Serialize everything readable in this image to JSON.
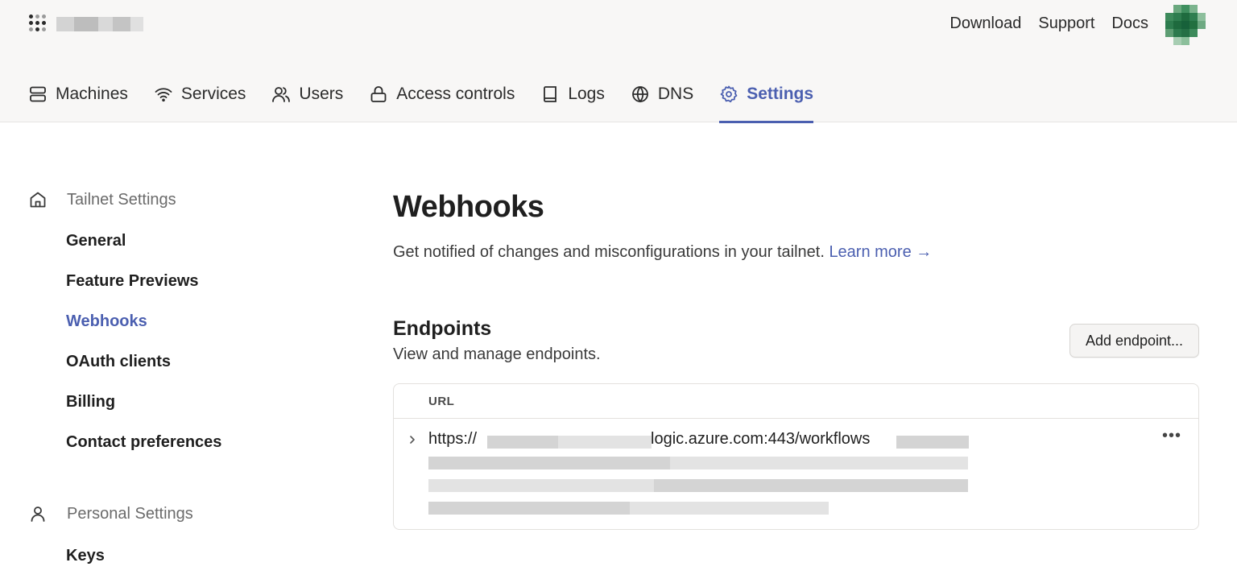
{
  "header": {
    "top_links": [
      "Download",
      "Support",
      "Docs"
    ]
  },
  "tabs": [
    {
      "label": "Machines",
      "icon": "server-icon"
    },
    {
      "label": "Services",
      "icon": "wifi-icon"
    },
    {
      "label": "Users",
      "icon": "users-icon"
    },
    {
      "label": "Access controls",
      "icon": "lock-icon"
    },
    {
      "label": "Logs",
      "icon": "book-icon"
    },
    {
      "label": "DNS",
      "icon": "globe-icon"
    },
    {
      "label": "Settings",
      "icon": "gear-icon",
      "active": true
    }
  ],
  "sidebar": {
    "tailnet_settings_label": "Tailnet Settings",
    "tailnet_items": [
      "General",
      "Feature Previews",
      "Webhooks",
      "OAuth clients",
      "Billing",
      "Contact preferences"
    ],
    "active_item": "Webhooks",
    "personal_settings_label": "Personal Settings",
    "personal_items": [
      "Keys"
    ]
  },
  "main": {
    "title": "Webhooks",
    "description": "Get notified of changes and misconfigurations in your tailnet.",
    "learn_more": "Learn more →",
    "endpoints": {
      "title": "Endpoints",
      "description": "View and manage endpoints.",
      "add_button": "Add endpoint...",
      "column_url": "URL",
      "rows": [
        {
          "url_prefix": "https://",
          "url_visible": "logic.azure.com:443/workflows",
          "more": "•••"
        }
      ]
    }
  },
  "colors": {
    "accent": "#4b5fb0",
    "header_bg": "#f8f7f6",
    "text": "#1f1f1f"
  }
}
